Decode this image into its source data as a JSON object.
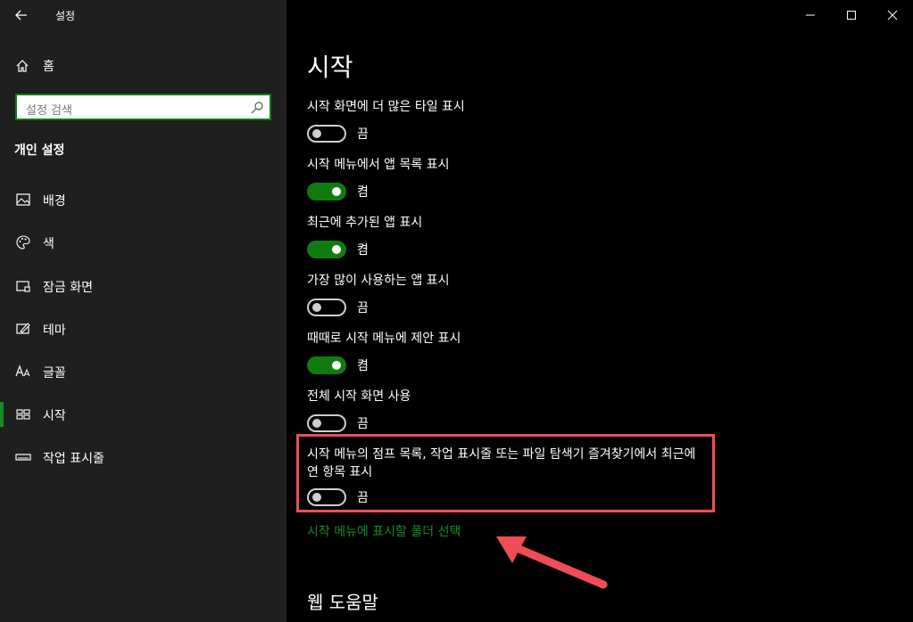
{
  "app": {
    "title": "설정"
  },
  "sidebar": {
    "home_label": "홈",
    "search_placeholder": "설정 검색",
    "section_title": "개인 설정",
    "items": [
      {
        "label": "배경",
        "icon": "image-icon"
      },
      {
        "label": "색",
        "icon": "palette-icon"
      },
      {
        "label": "잠금 화면",
        "icon": "lock-screen-icon"
      },
      {
        "label": "테마",
        "icon": "theme-icon"
      },
      {
        "label": "글꼴",
        "icon": "font-icon"
      },
      {
        "label": "시작",
        "icon": "start-icon",
        "active": true
      },
      {
        "label": "작업 표시줄",
        "icon": "taskbar-icon"
      }
    ]
  },
  "main": {
    "title": "시작",
    "settings": [
      {
        "label": "시작 화면에 더 많은 타일 표시",
        "state": "끔",
        "on": false
      },
      {
        "label": "시작 메뉴에서 앱 목록 표시",
        "state": "켬",
        "on": true
      },
      {
        "label": "최근에 추가된 앱 표시",
        "state": "켬",
        "on": true
      },
      {
        "label": "가장 많이 사용하는 앱 표시",
        "state": "끔",
        "on": false
      },
      {
        "label": "때때로 시작 메뉴에 제안 표시",
        "state": "켬",
        "on": true
      },
      {
        "label": "전체 시작 화면 사용",
        "state": "끔",
        "on": false
      },
      {
        "label": "시작 메뉴의 점프 목록, 작업 표시줄 또는 파일 탐색기 즐겨찾기에서 최근에 연 항목 표시",
        "state": "끔",
        "on": false
      }
    ],
    "link": "시작 메뉴에 표시할 폴더 선택",
    "subhead": "웹 도움말"
  },
  "colors": {
    "accent": "#107c10",
    "link": "#1a8a23",
    "highlight": "#ef4d56"
  }
}
